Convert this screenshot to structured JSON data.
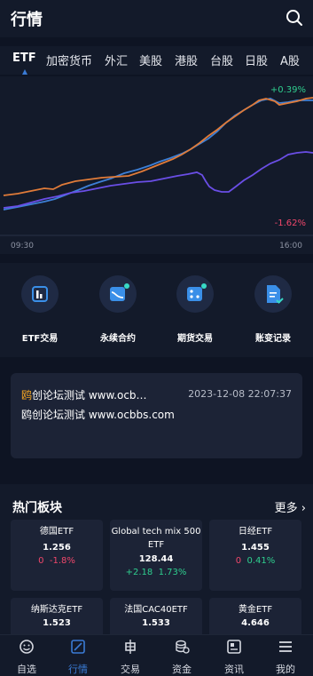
{
  "header": {
    "title": "行情"
  },
  "tabs": [
    "ETF",
    "加密货币",
    "外汇",
    "美股",
    "港股",
    "台股",
    "日股",
    "A股"
  ],
  "chart": {
    "top_label": "+0.39%",
    "bottom_label": "-1.62%",
    "time_start": "09:30",
    "time_end": "16:00",
    "colors": {
      "blue": "#3d7fd6",
      "orange": "#e07b39",
      "purple": "#6a4ee6"
    }
  },
  "quick": [
    {
      "label": "ETF交易",
      "icon": "chart-bars-icon"
    },
    {
      "label": "永续合约",
      "icon": "trend-curve-icon"
    },
    {
      "label": "期货交易",
      "icon": "dice-icon"
    },
    {
      "label": "账变记录",
      "icon": "document-check-icon"
    }
  ],
  "news": {
    "highlight": "鸥",
    "line1": "创论坛测试 www.ocb…",
    "time": "2023-12-08 22:07:37",
    "line2": "鸥创论坛测试 www.ocbbs.com"
  },
  "sector": {
    "title": "热门板块",
    "more": "更多",
    "cards": [
      {
        "name": "德国ETF",
        "price": "1.256",
        "change": "0",
        "pct": "-1.8%",
        "dir": "down"
      },
      {
        "name": "Global tech mix 500 ETF",
        "price": "128.44",
        "change": "+2.18",
        "pct": "1.73%",
        "dir": "up"
      },
      {
        "name": "日经ETF",
        "price": "1.455",
        "change": "0",
        "pct": "0.41%",
        "dir": "mixed"
      },
      {
        "name": "纳斯达克ETF",
        "price": "1.523"
      },
      {
        "name": "法国CAC40ETF",
        "price": "1.533"
      },
      {
        "name": "黄金ETF",
        "price": "4.646"
      }
    ]
  },
  "tabbar": [
    {
      "label": "自选",
      "icon": "smile-icon"
    },
    {
      "label": "行情",
      "icon": "chart-edit-icon",
      "active": true
    },
    {
      "label": "交易",
      "icon": "candle-icon"
    },
    {
      "label": "资金",
      "icon": "coins-icon"
    },
    {
      "label": "资讯",
      "icon": "news-icon"
    },
    {
      "label": "我的",
      "icon": "menu-icon"
    }
  ]
}
